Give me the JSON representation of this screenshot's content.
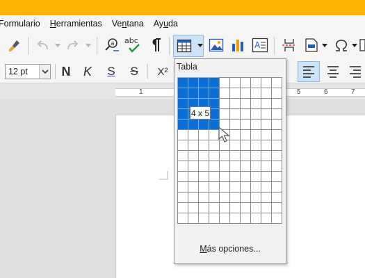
{
  "menubar": {
    "items": [
      {
        "label": "Formulario"
      },
      {
        "mn": "H",
        "rest": "erramientas"
      },
      {
        "pre": "Ve",
        "mn": "n",
        "rest": "tana"
      },
      {
        "pre": "Ay",
        "mn": "u",
        "rest": "da"
      }
    ]
  },
  "toolbar2": {
    "font_size": "12 pt",
    "bold": "N",
    "italic": "K",
    "underline": "S",
    "strikethrough": "S",
    "superscript": "X²"
  },
  "table_popup": {
    "title": "Tabla",
    "grid_columns": 10,
    "grid_rows": 14,
    "selected_columns": 4,
    "selected_rows": 5,
    "size_label": "4 x 5",
    "more_options": {
      "mn": "M",
      "rest": "ás opciones..."
    }
  },
  "ruler": {
    "labels": [
      "1",
      "5",
      "6",
      "7"
    ]
  },
  "colors": {
    "title_bar": "#ffb400",
    "selection": "#0a6fd8",
    "accent": "#2a5db0"
  }
}
